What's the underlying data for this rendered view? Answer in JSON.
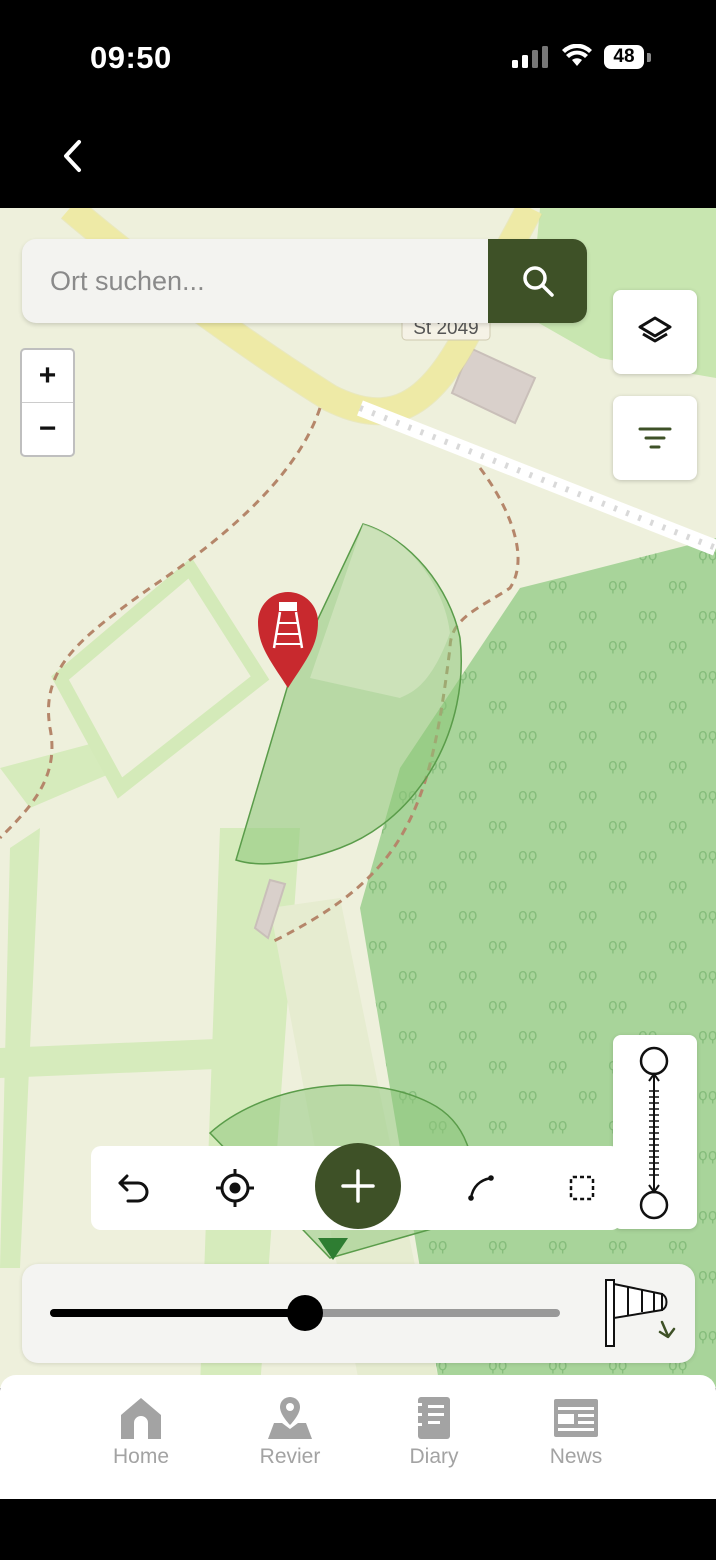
{
  "status_bar": {
    "time": "09:50",
    "battery": "48"
  },
  "map": {
    "road_label": "St 2049",
    "search": {
      "placeholder": "Ort suchen..."
    },
    "zoom_in_label": "+",
    "zoom_out_label": "−",
    "wind_slider": {
      "value_fraction": 0.5
    }
  },
  "tabs": [
    {
      "label": "Home",
      "icon": "home-icon"
    },
    {
      "label": "Revier",
      "icon": "revier-map-icon"
    },
    {
      "label": "Diary",
      "icon": "diary-icon"
    },
    {
      "label": "News",
      "icon": "news-icon"
    }
  ],
  "colors": {
    "accent": "#3e5127",
    "marker": "#c8292e",
    "forest": "#a8d49a"
  }
}
